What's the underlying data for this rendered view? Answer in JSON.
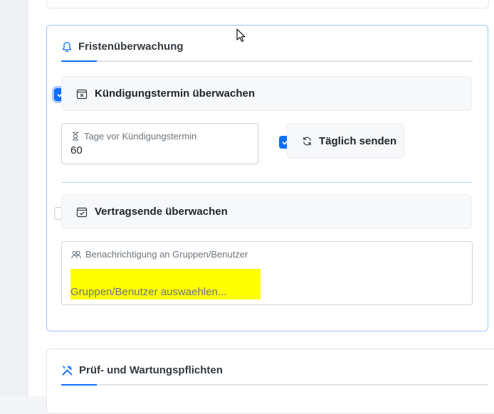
{
  "frist_section": {
    "title": "Fristenüberwachung",
    "kuendigung": {
      "label": "Kündigungstermin überwachen",
      "checked": true
    },
    "tage_field": {
      "label": "Tage vor Kündigungstermin",
      "value": "60"
    },
    "taeglich": {
      "label": "Täglich senden",
      "checked": true
    },
    "vertragsende": {
      "label": "Vertragsende überwachen",
      "checked": false
    },
    "notify_field": {
      "label": "Benachrichtigung an Gruppen/Benutzer",
      "placeholder": "Gruppen/Benutzer auswaehlen..."
    }
  },
  "pruef_section": {
    "title": "Prüf- und Wartungspflichten"
  },
  "icons": {
    "section_1": "bell-icon",
    "kuendigung": "calendar-x-icon",
    "tage": "hourglass-icon",
    "taeglich": "refresh-icon",
    "vertragsende": "calendar-check-icon",
    "notify": "people-icon",
    "section_2": "tools-icon"
  },
  "colors": {
    "accent": "#0d6efd",
    "card_border": "#9ec5fe",
    "highlight": "#ffff00"
  }
}
